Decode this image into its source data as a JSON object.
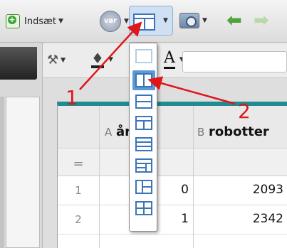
{
  "toolbar": {
    "insert_label": "Indsæt",
    "var_label": "var"
  },
  "layout_menu": {
    "options": [
      "blank",
      "two-columns",
      "two-rows",
      "header-and-two-columns",
      "three-rows",
      "left-and-two-stacked",
      "two-stacked-and-right",
      "four-quadrants"
    ]
  },
  "sheet": {
    "columns": [
      {
        "letter": "A",
        "name": "år"
      },
      {
        "letter": "B",
        "name": "robotter"
      }
    ],
    "formula_row_label": "=",
    "rows": [
      {
        "num": "1",
        "a": "0",
        "b": "2093"
      },
      {
        "num": "2",
        "a": "1",
        "b": "2342"
      }
    ]
  },
  "annotations": {
    "label_1": "1",
    "label_2": "2",
    "color": "#e0161b"
  },
  "colors": {
    "accent": "#3a75b9",
    "sheet_header": "#1f8c8f"
  }
}
